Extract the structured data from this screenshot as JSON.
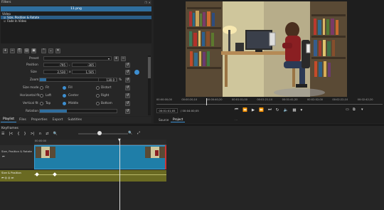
{
  "filters_panel": {
    "title": "Filters",
    "clip_name": "11.png",
    "section_label": "Video",
    "filters": [
      {
        "label": "Size, Position & Rotate",
        "checked": true,
        "selected": true
      },
      {
        "label": "Fade In Video",
        "checked": true,
        "selected": false
      }
    ],
    "preset_label": "Preset",
    "position_label": "Position",
    "position_x": "-795",
    "position_y": "-305",
    "size_label": "Size",
    "size_w": "2,530",
    "size_h": "1,505",
    "zoom_label": "Zoom",
    "zoom_value": "130.0",
    "zoom_unit": "%",
    "size_mode_label": "Size mode",
    "size_mode_options": [
      "Fit",
      "Fill",
      "Distort"
    ],
    "size_mode_selected": "Fill",
    "hfit_label": "Horizontal fit",
    "hfit_options": [
      "Left",
      "Center",
      "Right"
    ],
    "hfit_selected": "Center",
    "vfit_label": "Vertical fit",
    "vfit_options": [
      "Top",
      "Middle",
      "Bottom"
    ],
    "vfit_selected": "Middle",
    "rotation_label": "Rotation",
    "rotation_value": 0.35
  },
  "left_tabs": [
    "Playlist",
    "Files",
    "Properties",
    "Export",
    "Subtitles"
  ],
  "left_tab_active": "Playlist",
  "player": {
    "timecode": "00:01:01;05",
    "duration": "/ 00:04:00;05",
    "ruler_labels": [
      "00:00:00;00",
      "00:00:20;10",
      "00:00:40;20",
      "00:01:01;00",
      "00:01:21;10",
      "00:01:41;20",
      "00:02:02;00",
      "00:02:22;10",
      "00:02:42;20"
    ],
    "playhead": 0.22,
    "source_tab": "Source",
    "project_tab": "Project",
    "project_tab_active": true
  },
  "keyframes": {
    "title": "Keyframes",
    "track1_label": "Size, Position & Rotate",
    "ruler_start": "00:00:00",
    "track2_label": "Size & Position",
    "playhead": 0.3
  },
  "colors": {
    "accent": "#3d8fd1",
    "clip_teal": "#1f7ea8",
    "olive": "#6a6a22"
  }
}
